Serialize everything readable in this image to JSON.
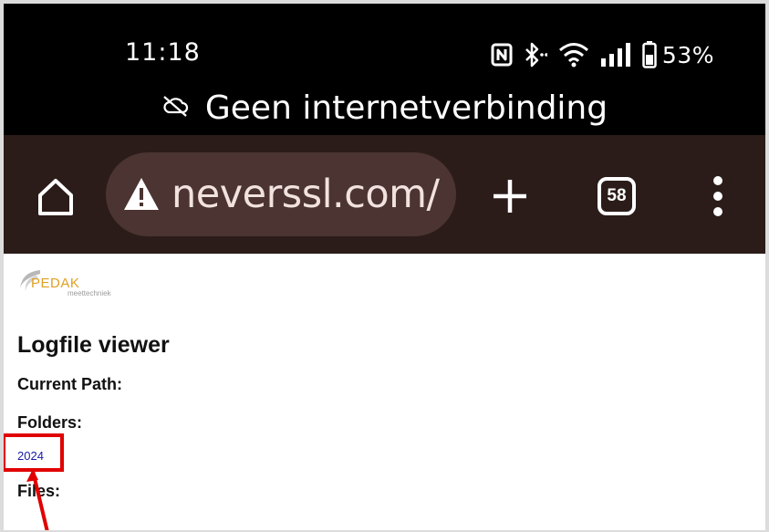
{
  "status_bar": {
    "time": "11:18",
    "battery_percent": "53%",
    "icons": [
      "nfc-icon",
      "bluetooth-icon",
      "wifi-icon",
      "signal-icon",
      "battery-icon"
    ]
  },
  "offline_banner": {
    "icon": "cloud-off-icon",
    "text": "Geen internetverbinding"
  },
  "browser": {
    "url": "neverssl.com/",
    "tab_count": "58",
    "icons": [
      "home-icon",
      "warning-icon",
      "plus-icon",
      "more-vert-icon"
    ]
  },
  "page": {
    "logo": {
      "name": "PEDAK",
      "subtitle": "meettechniek"
    },
    "heading": "Logfile viewer",
    "current_path_label": "Current Path:",
    "folders_label": "Folders:",
    "folders": [
      "2024"
    ],
    "files_label": "Files:"
  },
  "colors": {
    "status_bar_bg": "#000000",
    "toolbar_bg": "#2b1c1a",
    "url_pill_bg": "#4b3431",
    "link": "#1a1aa8",
    "annotation": "#e00000"
  }
}
